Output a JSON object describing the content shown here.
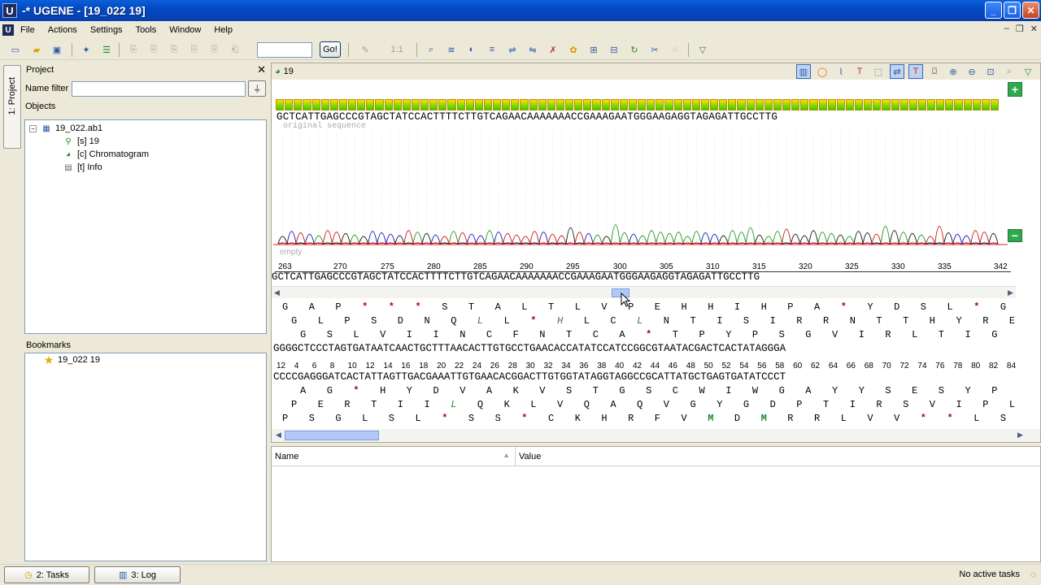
{
  "window": {
    "title": "-* UGENE - [19_022 19]",
    "app_letter": "U"
  },
  "menu": [
    "File",
    "Actions",
    "Settings",
    "Tools",
    "Window",
    "Help"
  ],
  "toolbar": {
    "go_label": "Go!",
    "ratio_label": "1:1",
    "goto_value": ""
  },
  "left_tab": {
    "label": "1: Project"
  },
  "project": {
    "title": "Project",
    "name_filter_label": "Name filter",
    "name_filter_value": "",
    "objects_label": "Objects",
    "tree": [
      {
        "label": "19_022.ab1",
        "icon": "document-folder-icon"
      },
      {
        "label": "[s] 19",
        "icon": "sequence-icon"
      },
      {
        "label": "[c] Chromatogram",
        "icon": "chromatogram-icon"
      },
      {
        "label": "[t] Info",
        "icon": "text-icon"
      }
    ]
  },
  "bookmarks": {
    "title": "Bookmarks",
    "items": [
      {
        "label": "19_022 19",
        "icon": "star-icon"
      }
    ]
  },
  "view": {
    "tab_label": "19",
    "chromatogram": {
      "top_sequence": "GCTCATTGAGCCCGTAGCTATCCACTTTTCTTGTCAGAACAAAAAAACCGAAAGAATGGGAAGAGGTAGAGATTGCCTTG",
      "original_label": "original sequence",
      "empty_label": "empty"
    },
    "ruler": {
      "ticks": [
        "263",
        "270",
        "275",
        "280",
        "285",
        "290",
        "295",
        "300",
        "305",
        "310",
        "315",
        "320",
        "325",
        "330",
        "335",
        "342"
      ],
      "sequence": "GCTCATTGAGCCCGTAGCTATCCACTTTTCTTGTCAGAACAAAAAAACCGAAAGAATGGGAAGAGGTAGAGATTGCCTTG"
    },
    "translation": {
      "frame1": [
        "G",
        "A",
        "P",
        "*",
        "*",
        "*",
        "S",
        "T",
        "A",
        "L",
        "T",
        "L",
        "V",
        "P",
        "E",
        "H",
        "H",
        "I",
        "H",
        "P",
        "A",
        "*",
        "Y",
        "D",
        "S",
        "L",
        "*",
        "G"
      ],
      "frame2": [
        "G",
        "L",
        "P",
        "S",
        "D",
        "N",
        "Q",
        "L",
        "L",
        "*",
        "H",
        "L",
        "C",
        "L",
        "N",
        "T",
        "I",
        "S",
        "I",
        "R",
        "R",
        "N",
        "T",
        "T",
        "H",
        "Y",
        "R",
        "E"
      ],
      "frame3": [
        "G",
        "S",
        "L",
        "V",
        "I",
        "I",
        "N",
        "C",
        "F",
        "N",
        "T",
        "C",
        "A",
        "*",
        "T",
        "P",
        "Y",
        "P",
        "S",
        "G",
        "V",
        "I",
        "R",
        "L",
        "T",
        "I",
        "G"
      ],
      "dna_forward": "GGGGCTCCCTAGTGATAATCAACTGCTTTAACACTTGTGCCTGAACACCATATCCATCCGGCGTAATACGACTCACTATAGGGA",
      "index_row": [
        "12",
        "4",
        "6",
        "8",
        "10",
        "12",
        "14",
        "16",
        "18",
        "20",
        "22",
        "24",
        "26",
        "28",
        "30",
        "32",
        "34",
        "36",
        "38",
        "40",
        "42",
        "44",
        "46",
        "48",
        "50",
        "52",
        "54",
        "56",
        "58",
        "60",
        "62",
        "64",
        "66",
        "68",
        "70",
        "72",
        "74",
        "76",
        "78",
        "80",
        "82",
        "84"
      ],
      "dna_complement": "CCCCGAGGGATCACTATTAGTTGACGAAATTGTGAACACGGACTTGTGGTATAGGTAGGCCGCATTATGCTGAGTGATATCCCT",
      "rframe1": [
        "A",
        "G",
        "*",
        "H",
        "Y",
        "D",
        "V",
        "A",
        "K",
        "V",
        "S",
        "T",
        "G",
        "S",
        "C",
        "W",
        "I",
        "W",
        "G",
        "A",
        "Y",
        "Y",
        "S",
        "E",
        "S",
        "Y",
        "P"
      ],
      "rframe2": [
        "P",
        "E",
        "R",
        "T",
        "I",
        "I",
        "L",
        "Q",
        "K",
        "L",
        "V",
        "Q",
        "A",
        "Q",
        "V",
        "G",
        "Y",
        "G",
        "D",
        "P",
        "T",
        "I",
        "R",
        "S",
        "V",
        "I",
        "P",
        "L"
      ],
      "rframe3": [
        "P",
        "S",
        "G",
        "L",
        "S",
        "L",
        "*",
        "S",
        "S",
        "*",
        "C",
        "K",
        "H",
        "R",
        "F",
        "V",
        "M",
        "D",
        "M",
        "R",
        "R",
        "L",
        "V",
        "V",
        "*",
        "*",
        "L",
        "S"
      ]
    }
  },
  "properties": {
    "col_name": "Name",
    "col_value": "Value"
  },
  "statusbar": {
    "tasks_label": "2: Tasks",
    "log_label": "3: Log",
    "status": "No active tasks"
  }
}
